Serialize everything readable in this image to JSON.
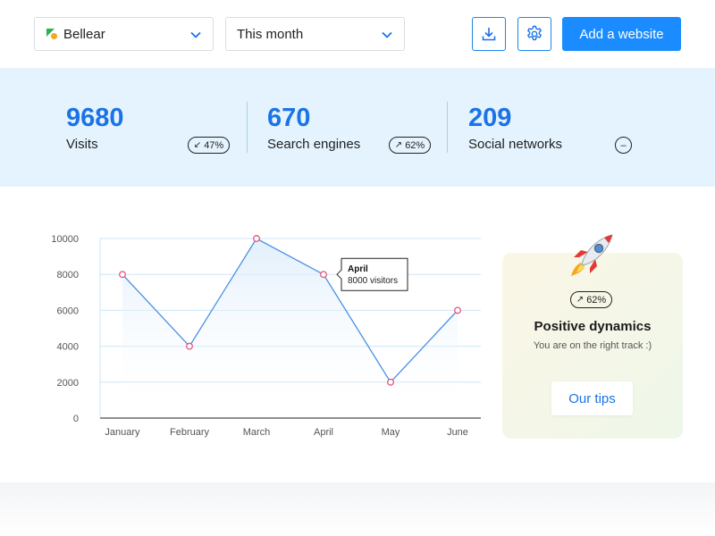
{
  "toolbar": {
    "site_select": {
      "value": "Bellear"
    },
    "period_select": {
      "value": "This month"
    },
    "add_label": "Add a website"
  },
  "stats": [
    {
      "value": "9680",
      "label": "Visits",
      "badge": "47%",
      "trend": "down"
    },
    {
      "value": "670",
      "label": "Search engines",
      "badge": "62%",
      "trend": "up"
    },
    {
      "value": "209",
      "label": "Social networks",
      "badge": "–",
      "trend": "neutral"
    }
  ],
  "chart_data": {
    "type": "area",
    "categories": [
      "January",
      "February",
      "March",
      "April",
      "May",
      "June"
    ],
    "values": [
      8000,
      4000,
      10000,
      8000,
      2000,
      6000
    ],
    "ylim": [
      0,
      10000
    ],
    "yticks": [
      0,
      2000,
      4000,
      6000,
      8000,
      10000
    ],
    "grid": true,
    "tooltip": {
      "category": "April",
      "title": "April",
      "text": "8000 visitors"
    }
  },
  "card": {
    "badge": "62%",
    "title": "Positive dynamics",
    "subtitle": "You are on the right track :)",
    "button_label": "Our tips"
  },
  "colors": {
    "accent": "#1a8cff",
    "stat_number": "#1a73e8",
    "band_bg": "#e4f3fd",
    "line": "#4a90e2",
    "marker": "#e8557a"
  },
  "icons": {
    "site_logo": "bellear-logo-icon",
    "download": "download-icon",
    "settings": "gear-icon",
    "card_art": "rocket-icon"
  }
}
